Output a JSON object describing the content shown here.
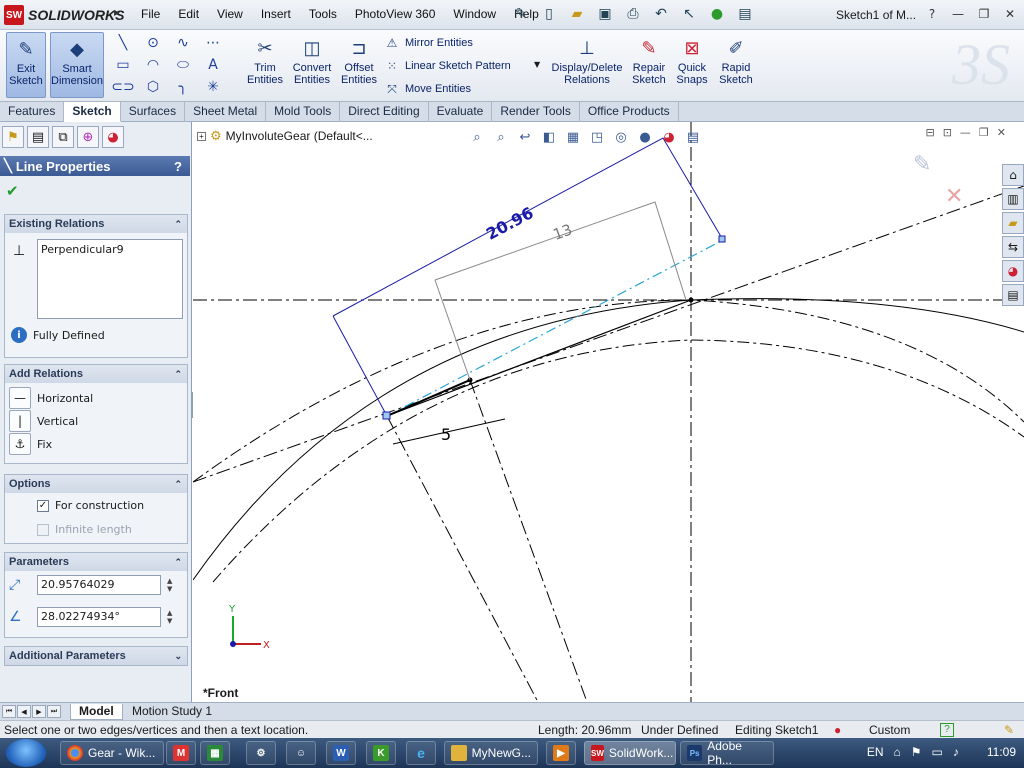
{
  "app": {
    "logo_text": "SOLIDWORKS",
    "menu": [
      "File",
      "Edit",
      "View",
      "Insert",
      "Tools",
      "PhotoView 360",
      "Window",
      "Help"
    ],
    "document_title": "Sketch1 of M...",
    "help_label": "?"
  },
  "ribbon": {
    "exit_sketch": "Exit\nSketch",
    "smart_dimension": "Smart\nDimension",
    "trim_entities": "Trim\nEntities",
    "convert_entities": "Convert\nEntities",
    "offset_entities": "Offset\nEntities",
    "mirror_entities": "Mirror Entities",
    "linear_sketch_pattern": "Linear Sketch Pattern",
    "move_entities": "Move Entities",
    "display_delete_relations": "Display/Delete\nRelations",
    "repair_sketch": "Repair\nSketch",
    "quick_snaps": "Quick\nSnaps",
    "rapid_sketch": "Rapid\nSketch"
  },
  "tabs": [
    "Features",
    "Sketch",
    "Surfaces",
    "Sheet Metal",
    "Mold Tools",
    "Direct Editing",
    "Evaluate",
    "Render Tools",
    "Office Products"
  ],
  "panel": {
    "title": "Line Properties",
    "help": "?",
    "existing_relations": {
      "header": "Existing Relations",
      "items": [
        "Perpendicular9"
      ],
      "status": "Fully Defined"
    },
    "add_relations": {
      "header": "Add Relations",
      "items": [
        "Horizontal",
        "Vertical",
        "Fix"
      ]
    },
    "options": {
      "header": "Options",
      "for_construction": "For construction",
      "infinite_length": "Infinite length"
    },
    "parameters": {
      "header": "Parameters",
      "length": "20.95764029",
      "angle": "28.02274934°"
    },
    "additional_parameters": {
      "header": "Additional Parameters"
    }
  },
  "canvas": {
    "tree_item": "MyInvoluteGear  (Default<...",
    "view_name": "*Front",
    "dim_length": "20.96",
    "dim_13": "13",
    "dim_5": "5",
    "axis_y": "Y",
    "axis_x": "X"
  },
  "bottom_tabs": [
    "Model",
    "Motion Study 1"
  ],
  "status": {
    "prompt": "Select one or two edges/vertices and then a text location.",
    "length": "Length: 20.96mm",
    "defined": "Under Defined",
    "editing": "Editing Sketch1",
    "units": "Custom",
    "help": "?"
  },
  "taskbar": {
    "items": [
      "Gear - Wik...",
      "MyNewG...",
      "SolidWork...",
      "Adobe Ph..."
    ],
    "lang": "EN",
    "time": "11:09"
  }
}
